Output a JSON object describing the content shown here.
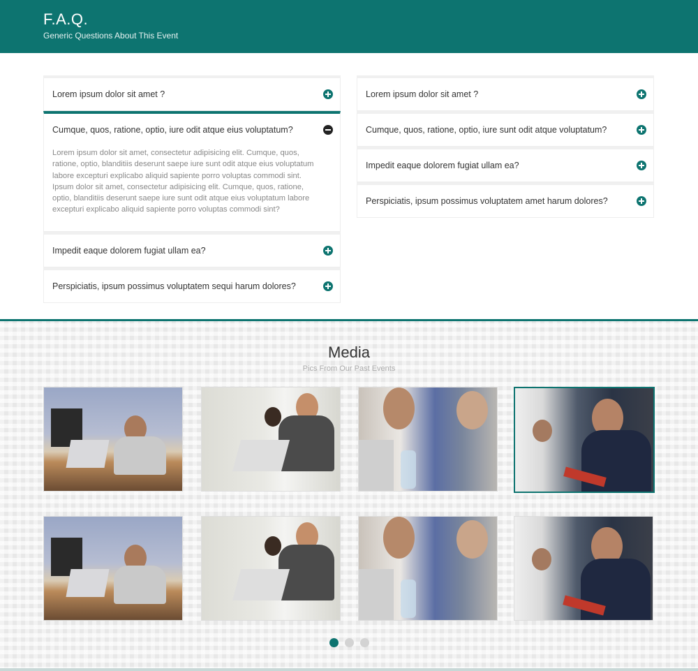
{
  "header": {
    "title": "F.A.Q.",
    "subtitle": "Generic Questions About This Event"
  },
  "faq_left": [
    {
      "question": "Lorem ipsum dolor sit amet ?",
      "open": false
    },
    {
      "question": "Cumque, quos, ratione, optio, iure odit atque eius voluptatum?",
      "open": true,
      "answer": "Lorem ipsum dolor sit amet, consectetur adipisicing elit. Cumque, quos, ratione, optio, blanditiis deserunt saepe iure sunt odit atque eius voluptatum labore excepturi explicabo aliquid sapiente porro voluptas commodi sint. Ipsum dolor sit amet, consectetur adipisicing elit. Cumque, quos, ratione, optio, blanditiis deserunt saepe iure sunt odit atque eius voluptatum labore excepturi explicabo aliquid sapiente porro voluptas commodi sint?"
    },
    {
      "question": "Impedit eaque dolorem fugiat ullam ea?",
      "open": false
    },
    {
      "question": "Perspiciatis, ipsum possimus voluptatem sequi harum dolores?",
      "open": false
    }
  ],
  "faq_right": [
    {
      "question": "Lorem ipsum dolor sit amet ?",
      "open": false
    },
    {
      "question": "Cumque, quos, ratione, optio, iure sunt odit atque voluptatum?",
      "open": false
    },
    {
      "question": "Impedit eaque dolorem fugiat ullam ea?",
      "open": false
    },
    {
      "question": "Perspiciatis, ipsum possimus voluptatem amet harum dolores?",
      "open": false
    }
  ],
  "icons": {
    "collapsed": "plus-circle-icon",
    "expanded": "minus-circle-icon"
  },
  "media": {
    "title": "Media",
    "subtitle": "Pics From Our Past Events",
    "photos": [
      {
        "name": "photo-man-headphones-laptop",
        "style": "p1",
        "active": false
      },
      {
        "name": "photo-group-discussion",
        "style": "p2",
        "active": false
      },
      {
        "name": "photo-men-at-table",
        "style": "p3",
        "active": false
      },
      {
        "name": "photo-man-phone",
        "style": "p4",
        "active": true
      },
      {
        "name": "photo-man-headphones-laptop",
        "style": "p1",
        "active": false
      },
      {
        "name": "photo-group-discussion",
        "style": "p2",
        "active": false
      },
      {
        "name": "photo-men-at-table",
        "style": "p3",
        "active": false
      },
      {
        "name": "photo-man-phone",
        "style": "p4",
        "active": false
      }
    ],
    "pagination": {
      "pages": 3,
      "current": 1
    }
  },
  "colors": {
    "accent": "#0d7470",
    "header_bg": "#0d7470"
  }
}
